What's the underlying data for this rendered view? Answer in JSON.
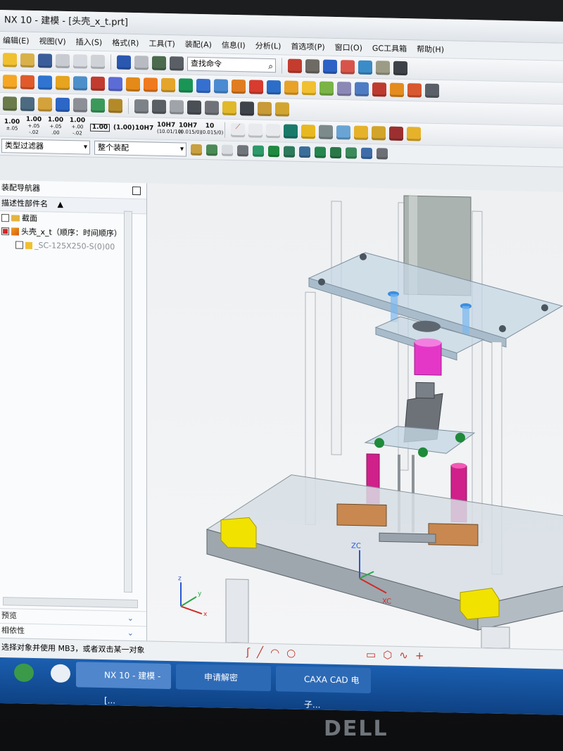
{
  "window": {
    "title": "NX 10 - 建模 - [头壳_x_t.prt]"
  },
  "menu": [
    "编辑(E)",
    "视图(V)",
    "插入(S)",
    "格式(R)",
    "工具(T)",
    "装配(A)",
    "信息(I)",
    "分析(L)",
    "首选项(P)",
    "窗口(O)",
    "GC工具箱",
    "帮助(H)"
  ],
  "search": {
    "placeholder": "查找命令"
  },
  "tolerances": [
    {
      "main": "1.00",
      "sub": "±.05"
    },
    {
      "main": "1.00",
      "sub": "+.05 -.02"
    },
    {
      "main": "1.00",
      "sub": "+.05 .00"
    },
    {
      "main": "1.00",
      "sub": "+.00 -.02"
    },
    {
      "main": "1.00",
      "sub": ""
    },
    {
      "main": "(1.00)",
      "sub": ""
    },
    {
      "main": "10H7",
      "sub": ""
    },
    {
      "main": "10H7",
      "sub": "(10.01/10)"
    },
    {
      "main": "10H7",
      "sub": "(0.015/0)"
    },
    {
      "main": "10",
      "sub": "(0.015/0)"
    }
  ],
  "filter": {
    "type_filter": "类型过滤器",
    "scope": "整个装配"
  },
  "navigator": {
    "title": "装配导航器",
    "column": "描述性部件名",
    "items": [
      {
        "label": "截面",
        "kind": "folder",
        "checked": false,
        "indent": 0
      },
      {
        "label": "头壳_x_t（顺序：时间顺序）",
        "kind": "assembly",
        "checked": true,
        "indent": 0
      },
      {
        "label": "_SC-125X250-S(0)00",
        "kind": "part",
        "checked": false,
        "indent": 1
      }
    ],
    "bottom_sections": [
      "预览",
      "相依性"
    ]
  },
  "viewport": {
    "axes": {
      "x": "x",
      "y": "y",
      "z": "z"
    },
    "wcs": {
      "z": "ZC",
      "x": "XC"
    }
  },
  "status": {
    "hint": "选择对象并使用 MB3，或者双击某一对象"
  },
  "taskbar": {
    "apps": [
      "NX 10 - 建模 - [...",
      "申请解密",
      "CAXA CAD 电子..."
    ]
  },
  "brand": "DELL",
  "colors": {
    "accent": "#1b5fb0",
    "magenta": "#e0208c",
    "yellow": "#f2e200"
  }
}
